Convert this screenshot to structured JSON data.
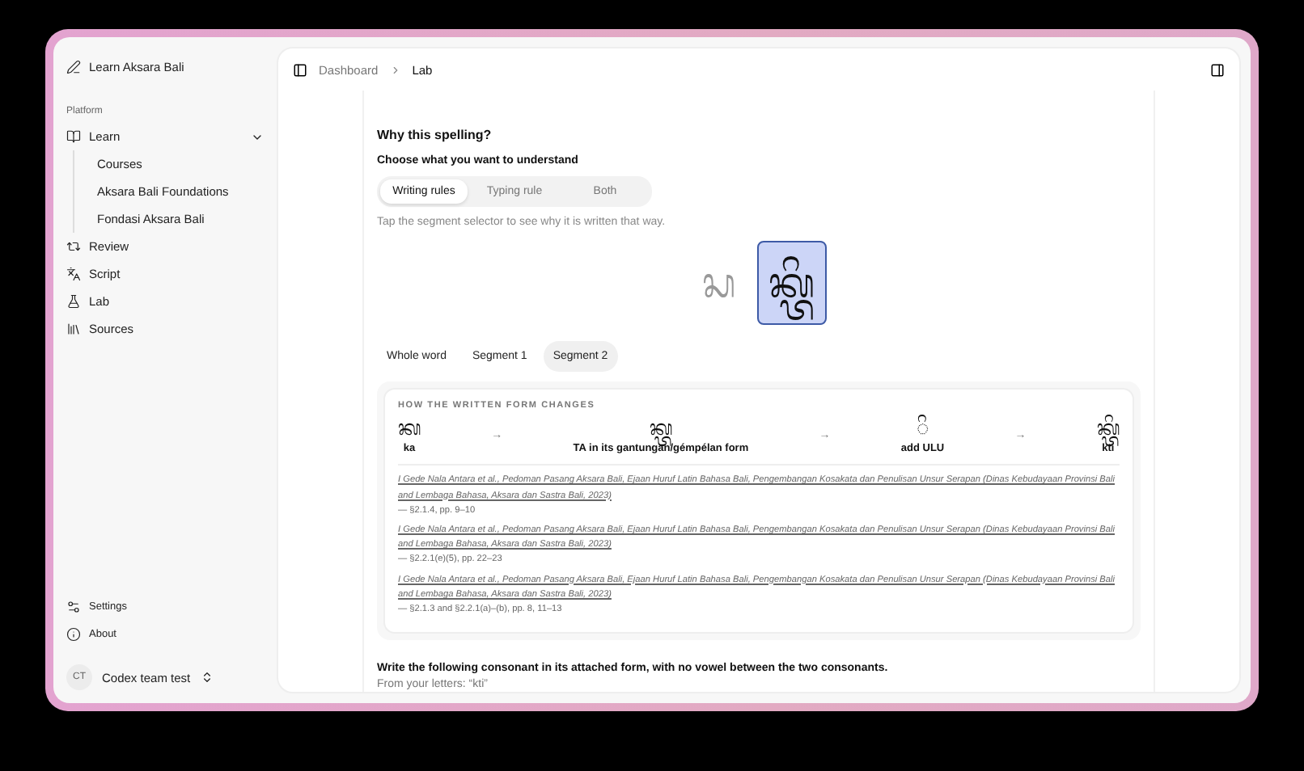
{
  "sidebar": {
    "app_title": "Learn Aksara Bali",
    "group_label": "Platform",
    "items": [
      {
        "label": "Learn",
        "kind": "book",
        "expanded": true,
        "children": [
          {
            "label": "Courses"
          },
          {
            "label": "Aksara Bali Foundations"
          },
          {
            "label": "Fondasi Aksara Bali"
          }
        ]
      },
      {
        "label": "Review",
        "kind": "review"
      },
      {
        "label": "Script",
        "kind": "script"
      },
      {
        "label": "Lab",
        "kind": "lab"
      },
      {
        "label": "Sources",
        "kind": "sources"
      }
    ],
    "footer_items": [
      {
        "label": "Settings",
        "kind": "settings"
      },
      {
        "label": "About",
        "kind": "about"
      }
    ],
    "user": {
      "initials": "CT",
      "name": "Codex team test"
    }
  },
  "breadcrumb": [
    "Dashboard",
    "Lab"
  ],
  "explain": {
    "title": "Why this spelling?",
    "prompt": "Choose what you want to understand",
    "modes": [
      {
        "label": "Writing rules",
        "selected": true
      },
      {
        "label": "Typing rule",
        "selected": false
      },
      {
        "label": "Both",
        "selected": false
      }
    ],
    "hint": "Tap the segment selector to see why it is written that way.",
    "glyph_segments": [
      {
        "text": "ᬲ",
        "selected": false
      },
      {
        "text": "ᬓ᭄ᬢᬶ",
        "selected": true
      }
    ],
    "segment_tabs": [
      {
        "label": "Whole word",
        "selected": false
      },
      {
        "label": "Segment 1",
        "selected": false
      },
      {
        "label": "Segment 2",
        "selected": true
      }
    ],
    "changes": {
      "heading": "HOW THE WRITTEN FORM CHANGES",
      "arrow": "→",
      "steps": [
        {
          "glyph": "ᬓ",
          "label": "ka"
        },
        {
          "glyph": "ᬓ᭄ᬢ",
          "label": "TA in its gantungan/gémpélan form"
        },
        {
          "glyph": "◌ᬶ",
          "label": "add ULU"
        },
        {
          "glyph": "ᬓ᭄ᬢᬶ",
          "label": "kti"
        }
      ],
      "citations": [
        {
          "source": "I Gede Nala Antara et al., Pedoman Pasang Aksara Bali, Ejaan Huruf Latin Bahasa Bali, Pengembangan Kosakata dan Penulisan Unsur Serapan (Dinas Kebudayaan Provinsi Bali and Lembaga Bahasa, Aksara dan Sastra Bali, 2023)",
          "locator": " — §2.1.4, pp. 9–10"
        },
        {
          "source": "I Gede Nala Antara et al., Pedoman Pasang Aksara Bali, Ejaan Huruf Latin Bahasa Bali, Pengembangan Kosakata dan Penulisan Unsur Serapan (Dinas Kebudayaan Provinsi Bali and Lembaga Bahasa, Aksara dan Sastra Bali, 2023)",
          "locator": " — §2.2.1(e)(5), pp. 22–23"
        },
        {
          "source": "I Gede Nala Antara et al., Pedoman Pasang Aksara Bali, Ejaan Huruf Latin Bahasa Bali, Pengembangan Kosakata dan Penulisan Unsur Serapan (Dinas Kebudayaan Provinsi Bali and Lembaga Bahasa, Aksara dan Sastra Bali, 2023)",
          "locator": " — §2.1.3 and §2.2.1(a)–(b), pp. 8, 11–13"
        }
      ]
    }
  },
  "exercise": {
    "instruction": "Write the following consonant in its attached form, with no vowel between the two consonants.",
    "from_letters": "From your letters: “kti”"
  }
}
